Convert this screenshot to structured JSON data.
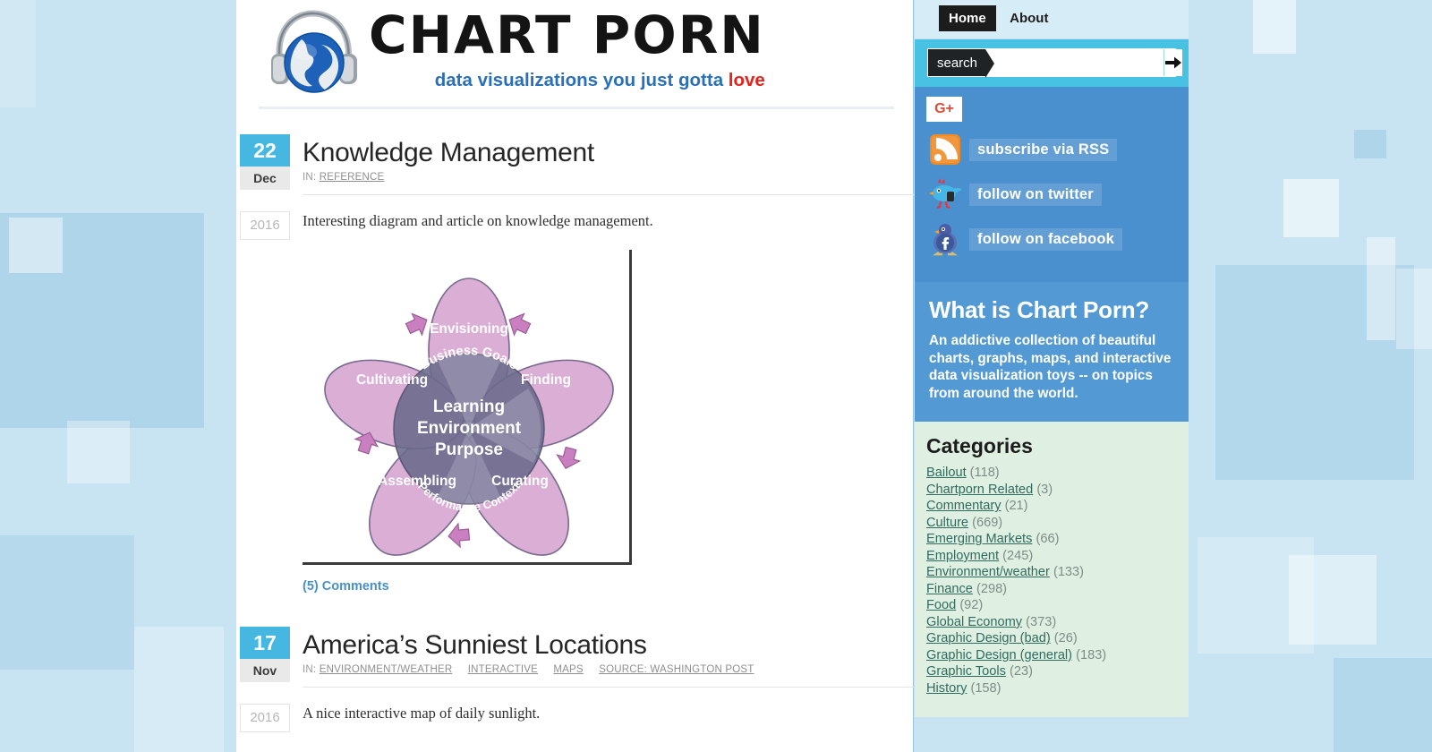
{
  "site": {
    "logo_title": "CHART PORN",
    "tagline_main": "data visualizations you just gotta ",
    "tagline_accent": "love",
    "logo_icon": "globe-headphones-icon"
  },
  "nav": {
    "items": [
      {
        "label": "Home",
        "active": true
      },
      {
        "label": "About",
        "active": false
      }
    ]
  },
  "search": {
    "tag_label": "search",
    "value": "",
    "placeholder": "",
    "submit_icon": "arrow-right-icon"
  },
  "social": {
    "gplus_label": "G+",
    "items": [
      {
        "label": "subscribe via RSS",
        "icon": "rss-icon"
      },
      {
        "label": "follow on twitter",
        "icon": "twitter-bird-icon"
      },
      {
        "label": "follow on facebook",
        "icon": "facebook-bird-icon"
      }
    ]
  },
  "about": {
    "heading": "What is Chart Porn?",
    "body": "An addictive collection of beautiful charts, graphs, maps, and interactive data visualization toys -- on topics from around the world."
  },
  "categories": {
    "heading": "Categories",
    "items": [
      {
        "name": "Bailout",
        "count": "(118)"
      },
      {
        "name": "Chartporn Related",
        "count": "(3)"
      },
      {
        "name": "Commentary",
        "count": "(21)"
      },
      {
        "name": "Culture",
        "count": "(669)"
      },
      {
        "name": "Emerging Markets",
        "count": "(66)"
      },
      {
        "name": "Employment",
        "count": "(245)"
      },
      {
        "name": "Environment/weather",
        "count": "(133)"
      },
      {
        "name": "Finance",
        "count": "(298)"
      },
      {
        "name": "Food",
        "count": "(92)"
      },
      {
        "name": "Global Economy",
        "count": "(373)"
      },
      {
        "name": "Graphic Design (bad)",
        "count": "(26)"
      },
      {
        "name": "Graphic Design (general)",
        "count": "(183)"
      },
      {
        "name": "Graphic Tools",
        "count": "(23)"
      },
      {
        "name": "History",
        "count": "(158)"
      }
    ]
  },
  "posts": [
    {
      "day": "22",
      "month": "Dec",
      "year": "2016",
      "title": "Knowledge Management",
      "in_label": "IN:",
      "tags": [
        "REFERENCE"
      ],
      "excerpt": "Interesting diagram and article on knowledge management.",
      "comments": "(5) Comments"
    },
    {
      "day": "17",
      "month": "Nov",
      "year": "2016",
      "title": "America’s Sunniest Locations",
      "in_label": "IN:",
      "tags": [
        "ENVIRONMENT/WEATHER",
        "INTERACTIVE",
        "MAPS",
        "SOURCE: WASHINGTON POST"
      ],
      "excerpt": "A nice interactive map of daily sunlight.",
      "comments": ""
    }
  ],
  "chart_data": {
    "type": "diagram",
    "diagram_kind": "flower-petal-venn",
    "title": "Learning Environment Purpose",
    "center_lines": [
      "Learning",
      "Environment",
      "Purpose"
    ],
    "center_arc_top": "Business Goals",
    "center_arc_bottom": "Performance Context",
    "petals": [
      {
        "label": "Envisioning",
        "angle_deg": 0
      },
      {
        "label": "Finding",
        "angle_deg": 72
      },
      {
        "label": "Curating",
        "angle_deg": 144
      },
      {
        "label": "Assembling",
        "angle_deg": 216
      },
      {
        "label": "Cultivating",
        "angle_deg": 288
      }
    ],
    "arrow_count": 5,
    "petal_color": "#d9a8d2",
    "petal_stroke": "#6d5f86",
    "center_color": "#6a6a8c",
    "arrow_color": "#c97fc0"
  },
  "theme": {
    "page_bg": "#c8e4f2",
    "content_bg": "#ffffff",
    "sidebar_blue": "#4a90cf",
    "search_band": "#47c2e2",
    "about_blue": "#539ad4",
    "categories_bg": "#dff0e3",
    "date_accent": "#45b7e0",
    "link_blue": "#4a90c8"
  }
}
